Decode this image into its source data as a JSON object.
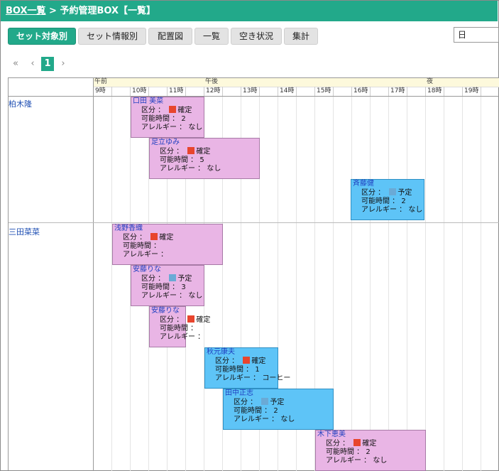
{
  "header": {
    "link": "BOX一覧",
    "sep": " > ",
    "title": "予約管理BOX【一覧】"
  },
  "tabs": [
    {
      "label": "セット対象別",
      "active": true
    },
    {
      "label": "セット情報別"
    },
    {
      "label": "配置図"
    },
    {
      "label": "一覧"
    },
    {
      "label": "空き状況"
    },
    {
      "label": "集計"
    }
  ],
  "view_select": {
    "value": "日"
  },
  "pager": {
    "first": "«",
    "prev": "‹",
    "current": "1",
    "next": "›"
  },
  "periods": [
    "午前",
    "午後",
    "夜"
  ],
  "hours": [
    "9時",
    "10時",
    "11時",
    "12時",
    "13時",
    "14時",
    "15時",
    "16時",
    "17時",
    "18時",
    "19時"
  ],
  "labels": {
    "kubun": "区分 ： ",
    "kanou": "可能時間 ： ",
    "allergy": "アレルギー ： "
  },
  "colors": {
    "header": "#22a98a",
    "confirmed": "#e8452d",
    "planned": "#6aaad6",
    "pink_block": "#e9b5e5",
    "blue_block": "#5ec4f7"
  },
  "people": [
    {
      "name": "柏木隆",
      "blocks": [
        {
          "name": "口田 美菜",
          "status": "確定",
          "hours": "2",
          "allergy": "なし"
        },
        {
          "name": "足立ゆみ",
          "status": "確定",
          "hours": "5",
          "allergy": "なし"
        },
        {
          "name": "斉藤健",
          "status": "予定",
          "hours": "2",
          "allergy": "なし"
        }
      ]
    },
    {
      "name": "三田菜菜",
      "blocks": [
        {
          "name": "浅野香織",
          "status": "確定",
          "hours": "",
          "allergy": ""
        },
        {
          "name": "安藤りな",
          "status": "予定",
          "hours": "3",
          "allergy": "なし"
        },
        {
          "name": "安藤りな",
          "status": "確定",
          "hours": "",
          "allergy": ""
        },
        {
          "name": "秋元康夫",
          "status": "確定",
          "hours": "1",
          "allergy": "コーヒー"
        },
        {
          "name": "田中正志",
          "status": "予定",
          "hours": "2",
          "allergy": "なし"
        },
        {
          "name": "木下恵美",
          "status": "確定",
          "hours": "2",
          "allergy": "なし"
        }
      ]
    }
  ]
}
